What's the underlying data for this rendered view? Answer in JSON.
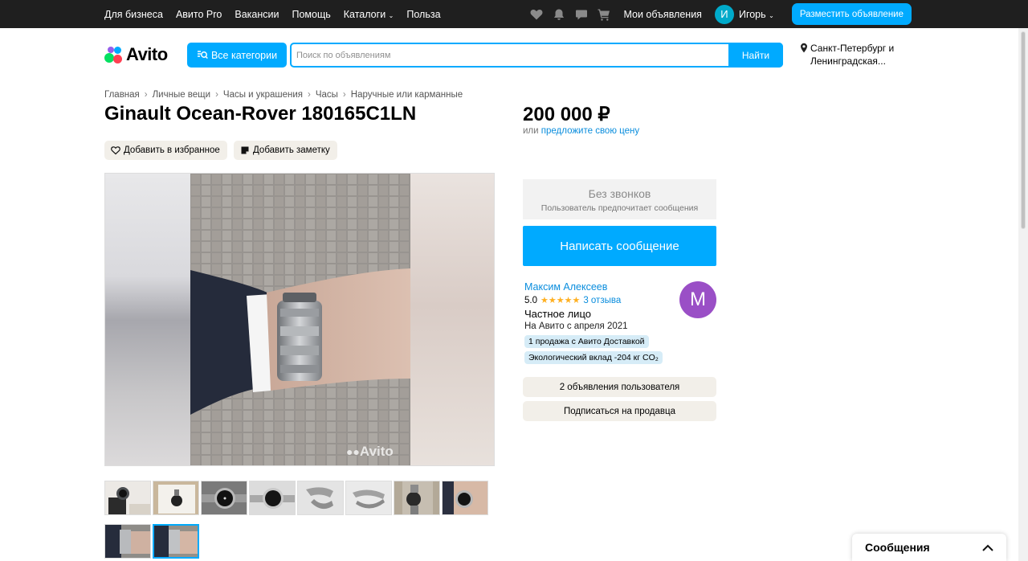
{
  "topbar": {
    "links": [
      "Для бизнеса",
      "Авито Pro",
      "Вакансии",
      "Помощь",
      "Каталоги",
      "Польза"
    ],
    "icons": [
      "heart-icon",
      "bell-icon",
      "chat-icon",
      "cart-icon"
    ],
    "my_ads": "Мои объявления",
    "avatar_letter": "И",
    "user_name": "Игорь",
    "post_button": "Разместить объявление"
  },
  "header": {
    "logo_text": "Avito",
    "categories_button": "Все категории",
    "search_placeholder": "Поиск по объявлениям",
    "search_button": "Найти",
    "location_line1": "Санкт-Петербург и",
    "location_line2": "Ленинградская..."
  },
  "breadcrumbs": [
    "Главная",
    "Личные вещи",
    "Часы и украшения",
    "Часы",
    "Наручные или карманные"
  ],
  "listing": {
    "title": "Ginault Ocean-Rover 180165C1LN",
    "add_favorite": "Добавить в избранное",
    "add_note": "Добавить заметку",
    "watermark": "Avito",
    "photo_count": 10,
    "selected_photo": 10
  },
  "pricing": {
    "price": "200 000 ₽",
    "offer_prefix": "или",
    "offer_link": "предложите свою цену"
  },
  "contact": {
    "no_calls_title": "Без звонков",
    "no_calls_subtitle": "Пользователь предпочитает сообщения",
    "message_button": "Написать сообщение"
  },
  "seller": {
    "name": "Максим Алексеев",
    "rating": "5.0",
    "stars": 5,
    "reviews": "3 отзыва",
    "type": "Частное лицо",
    "since": "На Авито с апреля 2021",
    "chip_delivery": "1 продажа с Авито Доставкой",
    "chip_eco": "Экологический вклад -204 кг CO₂",
    "avatar_letter": "М",
    "ads_button": "2 объявления пользователя",
    "subscribe_button": "Подписаться на продавца"
  },
  "messages_panel": {
    "label": "Сообщения"
  },
  "colors": {
    "accent": "#00aaff",
    "link": "#0a8ddd",
    "topbar": "#1f1f1f",
    "seller_avatar": "#9a4fc6",
    "star": "#ffb021"
  }
}
